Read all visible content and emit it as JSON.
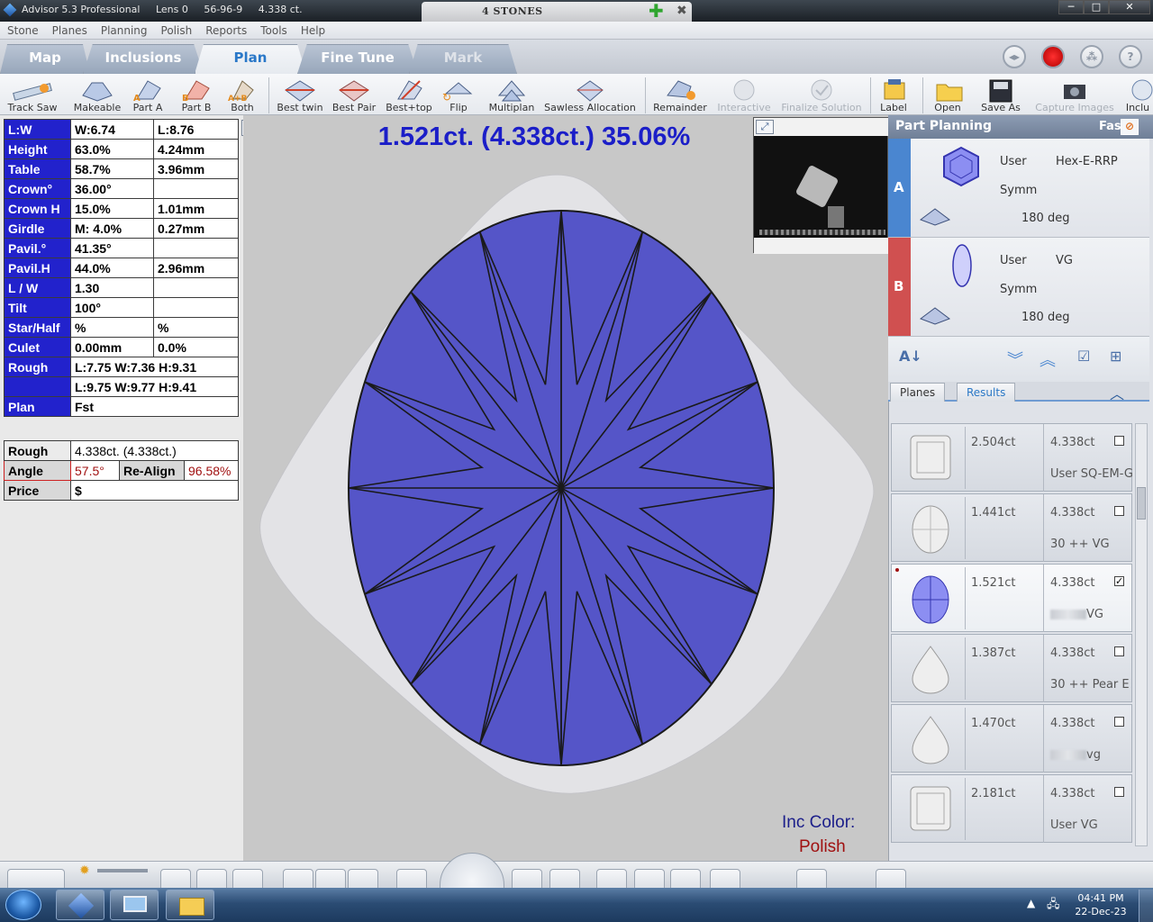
{
  "titlebar": {
    "title": "Advisor 5.3 Professional     Lens 0     56-96-9     4.338 ct.",
    "center_tab": "4 STONES",
    "minimize": "─",
    "maximize": "□",
    "close": "✕"
  },
  "menu": [
    "Stone",
    "Planes",
    "Planning",
    "Polish",
    "Reports",
    "Tools",
    "Help"
  ],
  "mode_tabs": [
    {
      "label": "Map"
    },
    {
      "label": "Inclusions"
    },
    {
      "label": "Plan"
    },
    {
      "label": "Fine Tune"
    },
    {
      "label": "Mark"
    }
  ],
  "toolbar": [
    {
      "label": "Track Saw",
      "icon": "track-saw-icon"
    },
    {
      "label": "Makeable",
      "icon": "makeable-icon"
    },
    {
      "label": "Part A",
      "icon": "part-a-icon"
    },
    {
      "label": "Part B",
      "icon": "part-b-icon"
    },
    {
      "label": "Both",
      "icon": "both-icon"
    },
    {
      "label": "Best twin",
      "icon": "best-twin-icon"
    },
    {
      "label": "Best Pair",
      "icon": "best-pair-icon"
    },
    {
      "label": "Best+top",
      "icon": "best-top-icon"
    },
    {
      "label": "Flip",
      "icon": "flip-icon"
    },
    {
      "label": "Multiplan",
      "icon": "multiplan-icon"
    },
    {
      "label": "Sawless Allocation",
      "icon": "sawless-icon"
    },
    {
      "label": "Remainder",
      "icon": "remainder-icon"
    },
    {
      "label": "Interactive",
      "icon": "interactive-icon"
    },
    {
      "label": "Finalize Solution",
      "icon": "finalize-icon"
    },
    {
      "label": "Label",
      "icon": "label-icon"
    },
    {
      "label": "Open",
      "icon": "folder-icon"
    },
    {
      "label": "Save As",
      "icon": "save-icon"
    },
    {
      "label": "Capture Images",
      "icon": "camera-icon"
    },
    {
      "label": "Inclu",
      "icon": "inclusion-icon"
    }
  ],
  "params": [
    {
      "k": "L:W",
      "v1": "W:6.74",
      "v2": "L:8.76"
    },
    {
      "k": "Height",
      "v1": "63.0%",
      "v2": "4.24mm"
    },
    {
      "k": "Table",
      "v1": "58.7%",
      "v2": "3.96mm"
    },
    {
      "k": "Crown°",
      "v1": "36.00°",
      "v2": ""
    },
    {
      "k": "Crown H",
      "v1": "15.0%",
      "v2": "1.01mm"
    },
    {
      "k": "Girdle",
      "v1": "M: 4.0%",
      "v2": "0.27mm"
    },
    {
      "k": "Pavil.°",
      "v1": "41.35°",
      "v2": ""
    },
    {
      "k": "Pavil.H",
      "v1": "44.0%",
      "v2": "2.96mm"
    },
    {
      "k": "L / W",
      "v1": "1.30",
      "v2": ""
    },
    {
      "k": "Tilt",
      "v1": "100°",
      "v2": ""
    },
    {
      "k": "Star/Half",
      "v1": "%",
      "v2": "%"
    },
    {
      "k": "Culet",
      "v1": "0.00mm",
      "v2": "0.0%"
    }
  ],
  "rough_rows": {
    "label": "Rough",
    "line1": "L:7.75 W:7.36 H:9.31",
    "line2": "L:9.75 W:9.77 H:9.41"
  },
  "plan_row": {
    "k": "Plan",
    "v": "Fst"
  },
  "summary": {
    "rough_label": "Rough",
    "rough_value": "4.338ct. (4.338ct.)",
    "angle_label": "Angle",
    "angle_value": "57.5°",
    "realign_label": "Re-Align",
    "realign_value": "96.58%",
    "price_label": "Price",
    "price_value": "$"
  },
  "headline": "1.521ct. (4.338ct.) 35.06%",
  "inc_color_label": "Inc Color:",
  "inc_color_value": "Polish",
  "part_planning": {
    "title": "Part Planning",
    "mode": "Fast",
    "parts": [
      {
        "label": "A",
        "user": "User",
        "shape": "Hex-E-RRP",
        "symm": "Symm",
        "deg": "180 deg",
        "color": "#4a86d0"
      },
      {
        "label": "B",
        "user": "User",
        "shape": "VG",
        "symm": "Symm",
        "deg": "180 deg",
        "color": "#d05050"
      }
    ]
  },
  "result_tabs": [
    "Planes",
    "Results"
  ],
  "results": [
    {
      "ct": "2.504ct",
      "rough": "4.338ct",
      "desc": "User SQ-EM-G",
      "checked": false,
      "shape": "square"
    },
    {
      "ct": "1.441ct",
      "rough": "4.338ct",
      "desc": "30 ++  VG",
      "checked": false,
      "shape": "oval"
    },
    {
      "ct": "1.521ct",
      "rough": "4.338ct",
      "desc": "VG",
      "checked": true,
      "shape": "oval-sel"
    },
    {
      "ct": "1.387ct",
      "rough": "4.338ct",
      "desc": "30 ++  Pear E",
      "checked": false,
      "shape": "pear"
    },
    {
      "ct": "1.470ct",
      "rough": "4.338ct",
      "desc": "vg",
      "checked": false,
      "shape": "pear"
    },
    {
      "ct": "2.181ct",
      "rough": "4.338ct",
      "desc": "User VG",
      "checked": false,
      "shape": "square"
    }
  ],
  "clock": {
    "time": "04:41 PM",
    "date": "22-Dec-23"
  },
  "colors": {
    "facet": "#5555c8",
    "param_key": "#2222cc",
    "headline": "#1b1ec8"
  }
}
